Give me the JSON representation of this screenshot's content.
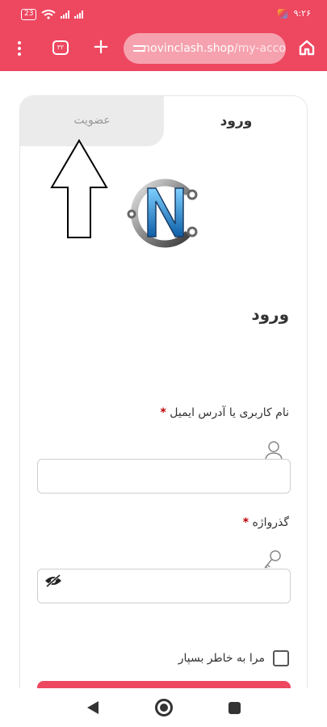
{
  "status_bar": {
    "battery": "23",
    "time": "۹:۲۶"
  },
  "browser": {
    "tab_count": "۳۲",
    "url_domain": "novinclash.shop",
    "url_path": "/my-acco"
  },
  "auth_tabs": {
    "login": "ورود",
    "register": "عضویت"
  },
  "form": {
    "title": "ورود",
    "username_label": "نام کاربری یا آدرس ایمیل",
    "password_label": "گذرواژه",
    "required_mark": "*",
    "remember_label": "مرا به خاطر بسپار"
  },
  "colors": {
    "brand": "#ee4760",
    "urlbar": "#f6a1ae",
    "inactive_tab": "#ebebeb"
  },
  "icons": [
    "menu-icon",
    "tabs-icon",
    "plus-icon",
    "tune-icon",
    "home-icon",
    "user-icon",
    "key-icon",
    "eye-off-icon",
    "up-arrow-annotation"
  ]
}
